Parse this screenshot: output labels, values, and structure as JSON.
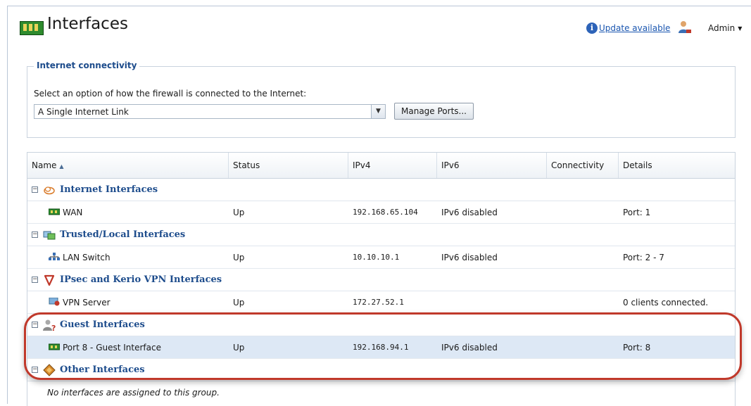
{
  "header": {
    "title": "Interfaces",
    "update_link": "Update available",
    "user": "Admin"
  },
  "connectivity": {
    "legend": "Internet connectivity",
    "prompt": "Select an option of how the firewall is connected to the Internet:",
    "selected": "A Single Internet Link",
    "manage_button": "Manage Ports..."
  },
  "grid": {
    "columns": [
      "Name",
      "Status",
      "IPv4",
      "IPv6",
      "Connectivity",
      "Details"
    ],
    "groups": [
      {
        "label": "Internet Interfaces",
        "rows": [
          {
            "name": "WAN",
            "status": "Up",
            "ipv4": "192.168.65.104",
            "ipv6": "IPv6 disabled",
            "connectivity": "",
            "details": "Port: 1"
          }
        ]
      },
      {
        "label": "Trusted/Local Interfaces",
        "rows": [
          {
            "name": "LAN Switch",
            "status": "Up",
            "ipv4": "10.10.10.1",
            "ipv6": "IPv6 disabled",
            "connectivity": "",
            "details": "Port: 2 - 7"
          }
        ]
      },
      {
        "label": "IPsec and Kerio VPN Interfaces",
        "rows": [
          {
            "name": "VPN Server",
            "status": "Up",
            "ipv4": "172.27.52.1",
            "ipv6": "",
            "connectivity": "",
            "details": "0 clients connected."
          }
        ]
      },
      {
        "label": "Guest Interfaces",
        "rows": [
          {
            "name": "Port 8 - Guest Interface",
            "status": "Up",
            "ipv4": "192.168.94.1",
            "ipv6": "IPv6 disabled",
            "connectivity": "",
            "details": "Port: 8"
          }
        ]
      },
      {
        "label": "Other Interfaces",
        "empty_text": "No interfaces are assigned to this group."
      }
    ]
  },
  "colors": {
    "accent": "#1d4c8c",
    "highlight": "#c0392b",
    "selected_row": "#dde8f5"
  }
}
